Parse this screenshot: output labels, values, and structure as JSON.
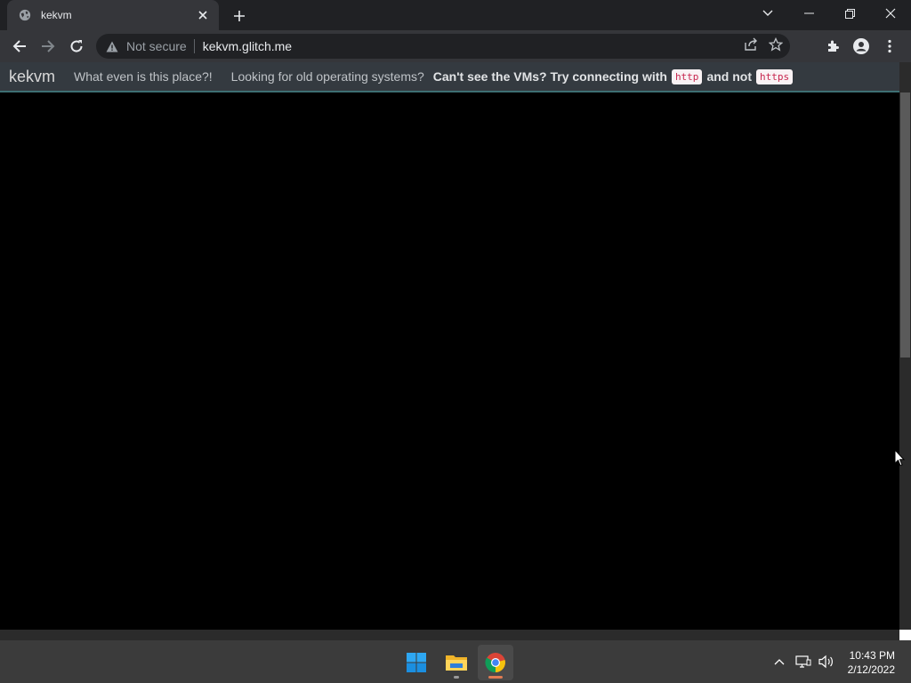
{
  "browser": {
    "tab": {
      "title": "kekvm"
    },
    "address": {
      "security": "Not secure",
      "url": "kekvm.glitch.me"
    }
  },
  "page": {
    "brand": "kekvm",
    "nav": {
      "about": "What even is this place?!",
      "old_os": "Looking for old operating systems?",
      "notice_prefix": "Can't see the VMs? Try connecting with",
      "code_http": "http",
      "notice_middle": "and not",
      "code_https": "https"
    }
  },
  "taskbar": {
    "clock": {
      "time": "10:43 PM",
      "date": "2/12/2022"
    }
  },
  "colors": {
    "tabstrip": "#202124",
    "toolbar": "#35363a",
    "nav_bg": "#343a40",
    "nav_accent": "#3e6f73",
    "code_text": "#c7254e",
    "code_bg": "#f9f2f4",
    "taskbar": "#3b3b3b"
  }
}
